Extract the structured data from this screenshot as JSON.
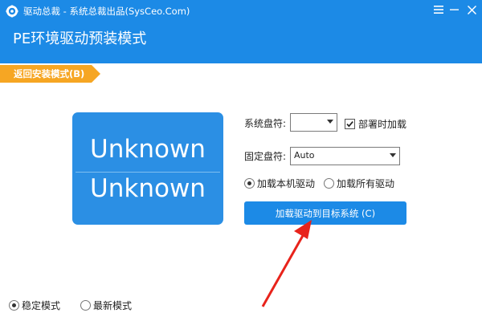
{
  "window": {
    "title": "驱动总裁 - 系统总裁出品(SysCeo.Com)",
    "controls": [
      "menu-icon",
      "minimize-icon",
      "close-icon"
    ]
  },
  "header": {
    "mode_title": "PE环境驱动预装模式"
  },
  "back_tab": {
    "label": "返回安装模式(B)"
  },
  "system_box": {
    "line1": "Unknown",
    "line2": "Unknown"
  },
  "form": {
    "system_drive_label": "系统盘符:",
    "system_drive_value": "",
    "deploy_load_label": "部署时加载",
    "deploy_load_checked": true,
    "fixed_drive_label": "固定盘符:",
    "fixed_drive_value": "Auto",
    "driver_scope": {
      "options": [
        "加载本机驱动",
        "加载所有驱动"
      ],
      "selected": "加载本机驱动"
    },
    "load_button_label": "加载驱动到目标系统 (C)"
  },
  "footer_modes": {
    "options": [
      "稳定模式",
      "最新模式"
    ],
    "selected": "稳定模式"
  },
  "colors": {
    "title_bar": "#1c8ae6",
    "system_box": "#2b8fe4",
    "back_tab": "#f6a623",
    "annotation_arrow": "#e8231b"
  }
}
